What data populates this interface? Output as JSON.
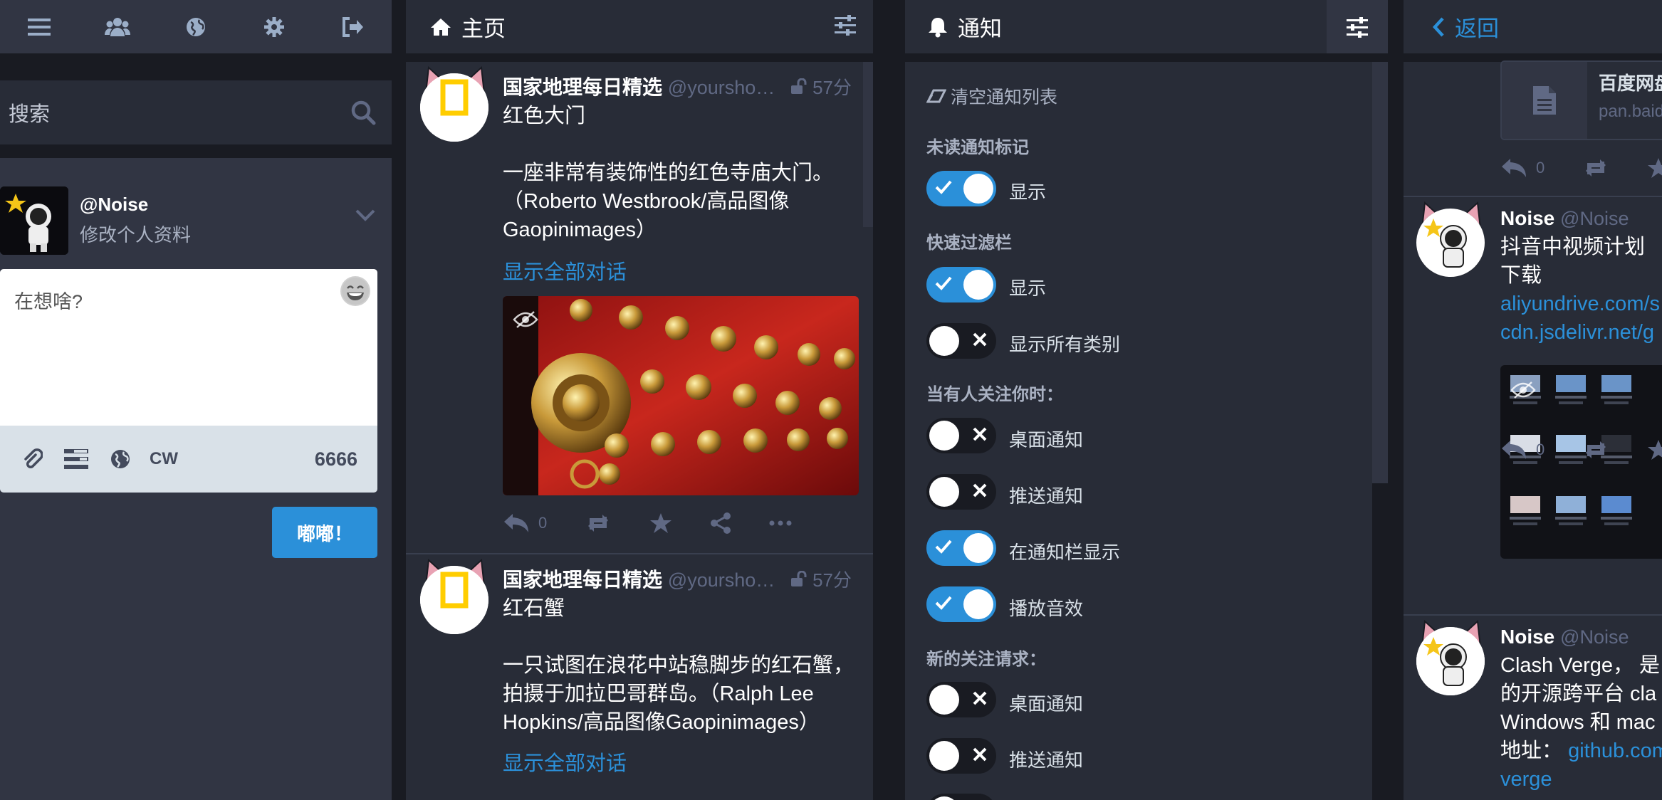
{
  "colors": {
    "accent": "#2b90d9",
    "panel": "#282c37",
    "background": "#191b22",
    "text": "#d9e1e8",
    "muted": "#606984"
  },
  "nav": {
    "icons": [
      "menu-icon",
      "users-icon",
      "globe-icon",
      "gear-icon",
      "logout-icon"
    ]
  },
  "search": {
    "placeholder": "搜索"
  },
  "account": {
    "handle": "@Noise",
    "edit_profile": "修改个人资料"
  },
  "compose": {
    "placeholder": "在想啥?",
    "cw_label": "CW",
    "char_count": "6666",
    "submit_label": "嘟嘟！"
  },
  "home": {
    "title": "主页",
    "statuses": [
      {
        "display_name": "国家地理每日精选",
        "handle": "@yoursho…",
        "time": "57分",
        "title": "红色大门",
        "body": "一座非常有装饰性的红色寺庙大门。（Roberto Westbrook/高品图像Gaopinimages）",
        "thread_link": "显示全部对话",
        "replies": "0"
      },
      {
        "display_name": "国家地理每日精选",
        "handle": "@yoursho…",
        "time": "57分",
        "title": "红石蟹",
        "body": "一只试图在浪花中站稳脚步的红石蟹，拍摄于加拉巴哥群岛。（Ralph Lee Hopkins/高品图像Gaopinimages）",
        "thread_link": "显示全部对话"
      }
    ],
    "avatar_text": "NATIONAL GEOGRAPHIC"
  },
  "notifications": {
    "title": "通知",
    "clear_label": "清空通知列表",
    "sections": {
      "unread_marker": "未读通知标记",
      "quick_filter": "快速过滤栏",
      "on_follow": "当有人关注你时：",
      "new_follow_request": "新的关注请求："
    },
    "toggles": [
      {
        "label": "显示",
        "state": true
      },
      {
        "label": "显示",
        "state": true
      },
      {
        "label": "显示所有类别",
        "state": false
      },
      {
        "label": "桌面通知",
        "state": false
      },
      {
        "label": "推送通知",
        "state": false
      },
      {
        "label": "在通知栏显示",
        "state": true
      },
      {
        "label": "播放音效",
        "state": true
      },
      {
        "label": "桌面通知",
        "state": false
      },
      {
        "label": "推送通知",
        "state": false
      }
    ]
  },
  "detail": {
    "back_label": "返回",
    "card": {
      "title": "百度网盘",
      "url": "pan.baidu"
    },
    "replies1": "0",
    "status1": {
      "display_name": "Noise",
      "handle": "@Noise",
      "text": "抖音中视频计划下载",
      "link1": "aliyundrive.com/s",
      "link2": "cdn.jsdelivr.net/g"
    },
    "replies2": "0",
    "status2": {
      "display_name": "Noise",
      "handle": "@Noise",
      "line1": "Clash Verge， 是",
      "line2": "的开源跨平台 cla",
      "line3": "Windows 和 mac",
      "line4": "地址：",
      "link": "github.com",
      "link_cont": "verge"
    }
  }
}
